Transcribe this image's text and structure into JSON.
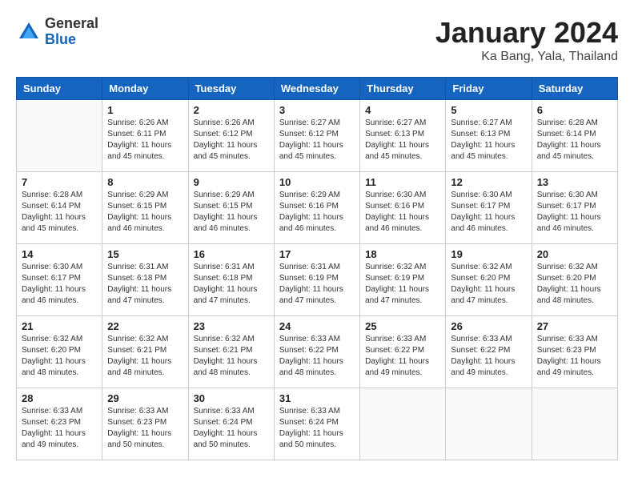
{
  "header": {
    "logo_general": "General",
    "logo_blue": "Blue",
    "title": "January 2024",
    "subtitle": "Ka Bang, Yala, Thailand"
  },
  "calendar": {
    "days_of_week": [
      "Sunday",
      "Monday",
      "Tuesday",
      "Wednesday",
      "Thursday",
      "Friday",
      "Saturday"
    ],
    "weeks": [
      [
        {
          "day": "",
          "info": ""
        },
        {
          "day": "1",
          "info": "Sunrise: 6:26 AM\nSunset: 6:11 PM\nDaylight: 11 hours and 45 minutes."
        },
        {
          "day": "2",
          "info": "Sunrise: 6:26 AM\nSunset: 6:12 PM\nDaylight: 11 hours and 45 minutes."
        },
        {
          "day": "3",
          "info": "Sunrise: 6:27 AM\nSunset: 6:12 PM\nDaylight: 11 hours and 45 minutes."
        },
        {
          "day": "4",
          "info": "Sunrise: 6:27 AM\nSunset: 6:13 PM\nDaylight: 11 hours and 45 minutes."
        },
        {
          "day": "5",
          "info": "Sunrise: 6:27 AM\nSunset: 6:13 PM\nDaylight: 11 hours and 45 minutes."
        },
        {
          "day": "6",
          "info": "Sunrise: 6:28 AM\nSunset: 6:14 PM\nDaylight: 11 hours and 45 minutes."
        }
      ],
      [
        {
          "day": "7",
          "info": "Sunrise: 6:28 AM\nSunset: 6:14 PM\nDaylight: 11 hours and 45 minutes."
        },
        {
          "day": "8",
          "info": "Sunrise: 6:29 AM\nSunset: 6:15 PM\nDaylight: 11 hours and 46 minutes."
        },
        {
          "day": "9",
          "info": "Sunrise: 6:29 AM\nSunset: 6:15 PM\nDaylight: 11 hours and 46 minutes."
        },
        {
          "day": "10",
          "info": "Sunrise: 6:29 AM\nSunset: 6:16 PM\nDaylight: 11 hours and 46 minutes."
        },
        {
          "day": "11",
          "info": "Sunrise: 6:30 AM\nSunset: 6:16 PM\nDaylight: 11 hours and 46 minutes."
        },
        {
          "day": "12",
          "info": "Sunrise: 6:30 AM\nSunset: 6:17 PM\nDaylight: 11 hours and 46 minutes."
        },
        {
          "day": "13",
          "info": "Sunrise: 6:30 AM\nSunset: 6:17 PM\nDaylight: 11 hours and 46 minutes."
        }
      ],
      [
        {
          "day": "14",
          "info": "Sunrise: 6:30 AM\nSunset: 6:17 PM\nDaylight: 11 hours and 46 minutes."
        },
        {
          "day": "15",
          "info": "Sunrise: 6:31 AM\nSunset: 6:18 PM\nDaylight: 11 hours and 47 minutes."
        },
        {
          "day": "16",
          "info": "Sunrise: 6:31 AM\nSunset: 6:18 PM\nDaylight: 11 hours and 47 minutes."
        },
        {
          "day": "17",
          "info": "Sunrise: 6:31 AM\nSunset: 6:19 PM\nDaylight: 11 hours and 47 minutes."
        },
        {
          "day": "18",
          "info": "Sunrise: 6:32 AM\nSunset: 6:19 PM\nDaylight: 11 hours and 47 minutes."
        },
        {
          "day": "19",
          "info": "Sunrise: 6:32 AM\nSunset: 6:20 PM\nDaylight: 11 hours and 47 minutes."
        },
        {
          "day": "20",
          "info": "Sunrise: 6:32 AM\nSunset: 6:20 PM\nDaylight: 11 hours and 48 minutes."
        }
      ],
      [
        {
          "day": "21",
          "info": "Sunrise: 6:32 AM\nSunset: 6:20 PM\nDaylight: 11 hours and 48 minutes."
        },
        {
          "day": "22",
          "info": "Sunrise: 6:32 AM\nSunset: 6:21 PM\nDaylight: 11 hours and 48 minutes."
        },
        {
          "day": "23",
          "info": "Sunrise: 6:32 AM\nSunset: 6:21 PM\nDaylight: 11 hours and 48 minutes."
        },
        {
          "day": "24",
          "info": "Sunrise: 6:33 AM\nSunset: 6:22 PM\nDaylight: 11 hours and 48 minutes."
        },
        {
          "day": "25",
          "info": "Sunrise: 6:33 AM\nSunset: 6:22 PM\nDaylight: 11 hours and 49 minutes."
        },
        {
          "day": "26",
          "info": "Sunrise: 6:33 AM\nSunset: 6:22 PM\nDaylight: 11 hours and 49 minutes."
        },
        {
          "day": "27",
          "info": "Sunrise: 6:33 AM\nSunset: 6:23 PM\nDaylight: 11 hours and 49 minutes."
        }
      ],
      [
        {
          "day": "28",
          "info": "Sunrise: 6:33 AM\nSunset: 6:23 PM\nDaylight: 11 hours and 49 minutes."
        },
        {
          "day": "29",
          "info": "Sunrise: 6:33 AM\nSunset: 6:23 PM\nDaylight: 11 hours and 50 minutes."
        },
        {
          "day": "30",
          "info": "Sunrise: 6:33 AM\nSunset: 6:24 PM\nDaylight: 11 hours and 50 minutes."
        },
        {
          "day": "31",
          "info": "Sunrise: 6:33 AM\nSunset: 6:24 PM\nDaylight: 11 hours and 50 minutes."
        },
        {
          "day": "",
          "info": ""
        },
        {
          "day": "",
          "info": ""
        },
        {
          "day": "",
          "info": ""
        }
      ]
    ]
  }
}
